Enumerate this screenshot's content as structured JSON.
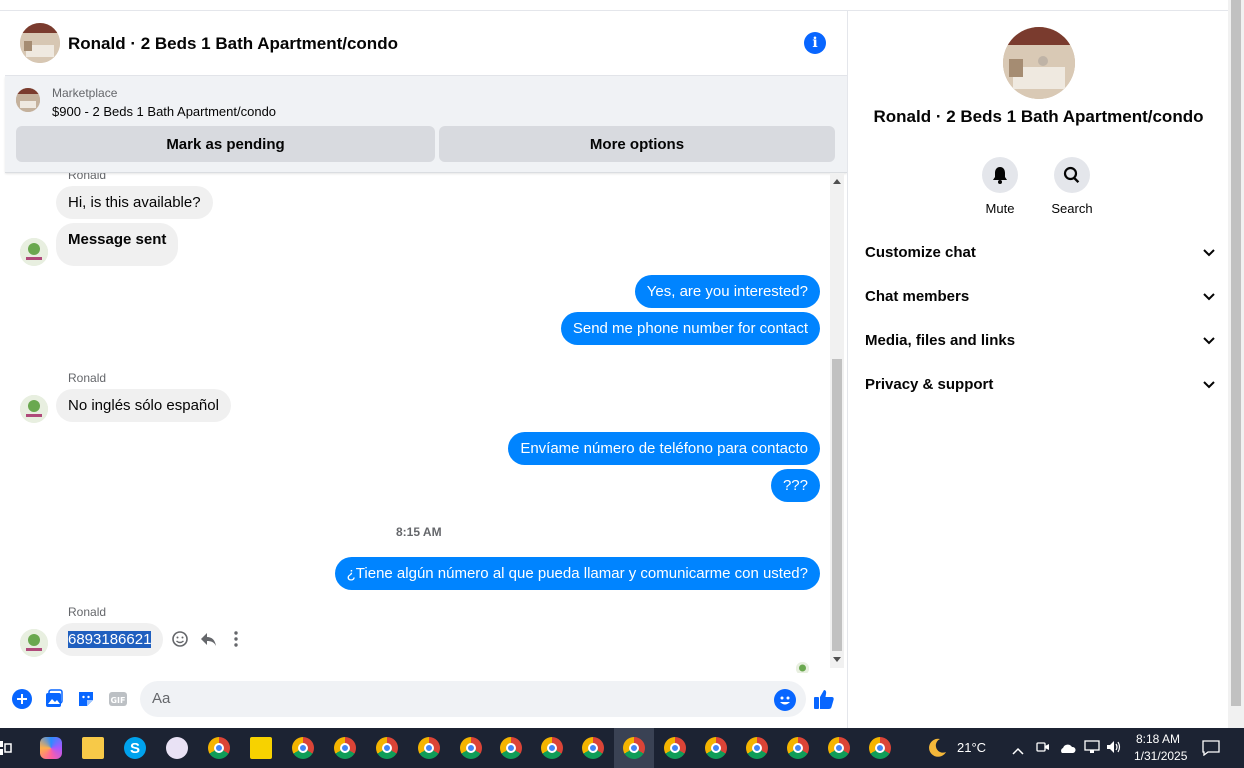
{
  "chat": {
    "title": "Ronald · 2 Beds 1 Bath Apartment/condo",
    "marketplace_label": "Marketplace",
    "marketplace_title": "$900 - 2 Beds 1 Bath Apartment/condo",
    "mark_pending": "Mark as pending",
    "more_options": "More options",
    "composer_placeholder": "Aa",
    "timestamp": "8:15 AM",
    "messages": {
      "sender_top": "Ronald",
      "m1": "Hi, is this available?",
      "m2": "Message sent",
      "m3": "Yes, are you interested?",
      "m4": "Send me phone number for contact",
      "sender2": "Ronald",
      "m5": "No inglés sólo español",
      "m6": "Envíame número de teléfono para contacto",
      "m7": "???",
      "m8": "¿Tiene algún número al que pueda llamar y comunicarme con usted?",
      "sender3": "Ronald",
      "m9": "6893186621"
    }
  },
  "panel": {
    "title": "Ronald · 2 Beds 1 Bath Apartment/condo",
    "mute": "Mute",
    "search": "Search",
    "sections": [
      "Customize chat",
      "Chat members",
      "Media, files and links",
      "Privacy & support"
    ]
  },
  "taskbar": {
    "weather": "21°C",
    "time": "8:18 AM",
    "date": "1/31/2025"
  },
  "colors": {
    "accent": "#0866ff",
    "outgoing_bubble": "#0084ff",
    "incoming_bubble": "#f0f0f0"
  }
}
